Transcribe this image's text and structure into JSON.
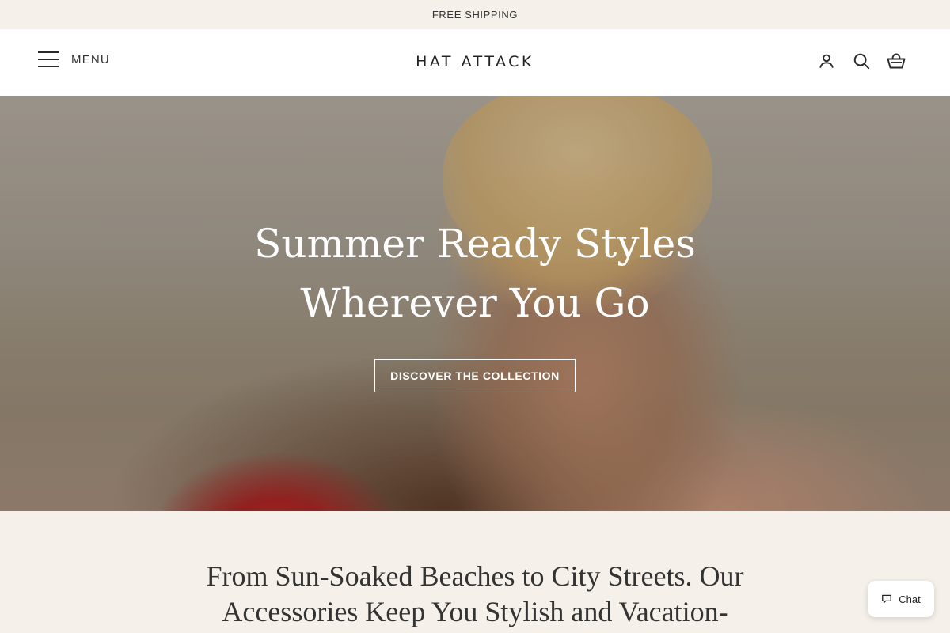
{
  "announcement": {
    "text": "FREE SHIPPING"
  },
  "header": {
    "menu_label": "MENU",
    "logo": "HAT ATTACK",
    "icons": [
      "account-icon",
      "search-icon",
      "cart-icon"
    ]
  },
  "hero": {
    "title_line1": "Summer Ready Styles",
    "title_line2": "Wherever You Go",
    "cta_label": "DISCOVER THE COLLECTION"
  },
  "intro": {
    "text": "From Sun-Soaked Beaches to City Streets. Our Accessories Keep You Stylish and Vacation-"
  },
  "chat": {
    "label": "Chat"
  },
  "colors": {
    "background": "#f5f1ea",
    "header_bg": "#ffffff",
    "text": "#2a2a2a"
  }
}
